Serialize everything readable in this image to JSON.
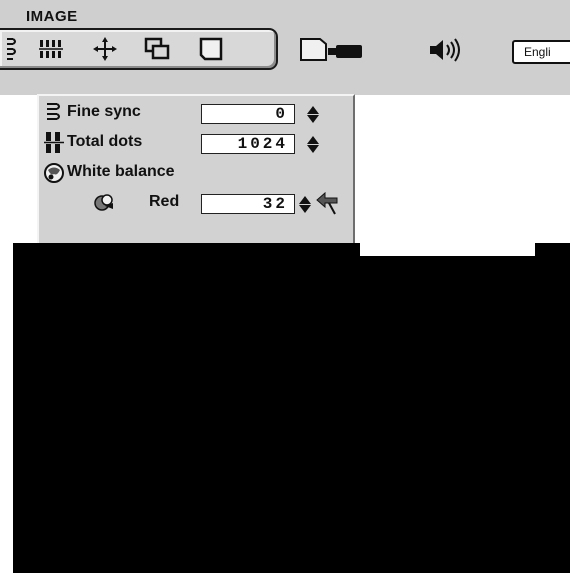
{
  "menubar": {
    "title": "IMAGE",
    "language": "Engli"
  },
  "panel": {
    "rows": [
      {
        "label": "Fine sync",
        "value": "0"
      },
      {
        "label": "Total dots",
        "value": "1024"
      },
      {
        "label": "White balance"
      },
      {
        "label": "Red",
        "value": "32"
      }
    ]
  },
  "colors": {
    "menubar_bg": "#cfcfcf",
    "panel_bg": "#d2d2d2",
    "redaction": "#000000"
  },
  "icons": [
    "fine-sync-icon",
    "total-dots-icon",
    "position-icon",
    "pc-adjust-icon",
    "screen-icon",
    "projector-icon",
    "speaker-icon",
    "white-balance-icon",
    "red-channel-icon",
    "up-down-arrows-icon",
    "back-arrow-icon"
  ]
}
